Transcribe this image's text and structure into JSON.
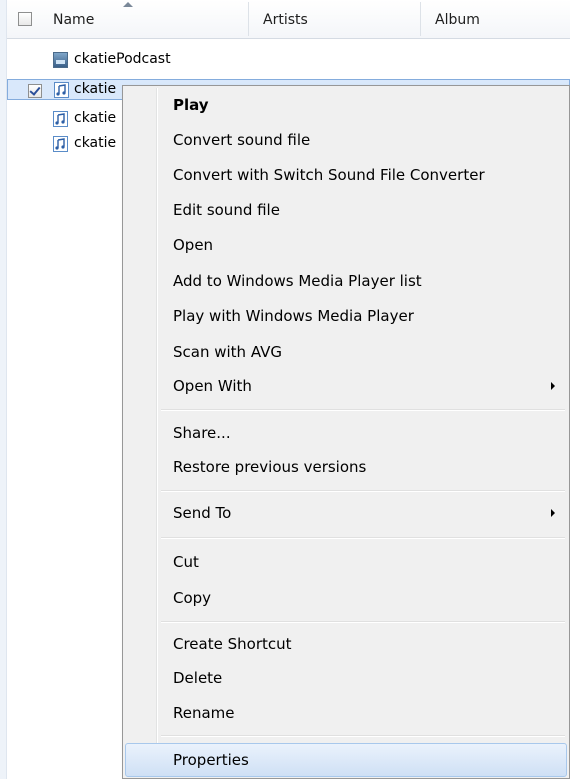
{
  "columns": {
    "name": "Name",
    "artists": "Artists",
    "album": "Album"
  },
  "files": [
    {
      "name": "ckatiePodcast",
      "type": "video-icon",
      "checked": false
    },
    {
      "name": "ckatie",
      "type": "audio-icon",
      "checked": true
    },
    {
      "name": "ckatie",
      "type": "audio-icon",
      "checked": false
    },
    {
      "name": "ckatie",
      "type": "audio-icon",
      "checked": false
    }
  ],
  "menu": {
    "play": "Play",
    "convert": "Convert sound file",
    "convert_switch": "Convert with Switch Sound File Converter",
    "edit": "Edit sound file",
    "open": "Open",
    "add_wmp": "Add to Windows Media Player list",
    "play_wmp": "Play with Windows Media Player",
    "scan_avg": "Scan with AVG",
    "open_with": "Open With",
    "share": "Share...",
    "restore": "Restore previous versions",
    "send_to": "Send To",
    "cut": "Cut",
    "copy": "Copy",
    "create_shortcut": "Create Shortcut",
    "delete": "Delete",
    "rename": "Rename",
    "properties": "Properties"
  },
  "colors": {
    "selection": "#d9e8fb",
    "menu_bg": "#f0f0f0",
    "hover": "#cfe0f5"
  }
}
